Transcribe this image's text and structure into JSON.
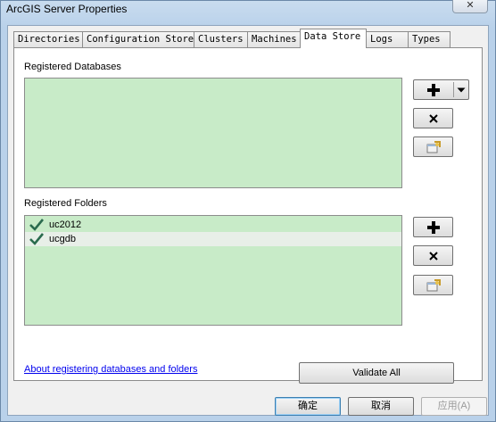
{
  "window": {
    "title": "ArcGIS Server Properties",
    "close_label": "✕"
  },
  "tabs": [
    {
      "label": "Directories"
    },
    {
      "label": "Configuration Store"
    },
    {
      "label": "Clusters"
    },
    {
      "label": "Machines"
    },
    {
      "label": "Data Store"
    },
    {
      "label": "Logs"
    },
    {
      "label": "Types"
    }
  ],
  "active_tab": "Data Store",
  "databases": {
    "label": "Registered Databases",
    "items": []
  },
  "folders": {
    "label": "Registered Folders",
    "items": [
      {
        "name": "uc2012",
        "status_icon": "check-icon"
      },
      {
        "name": "ucgdb",
        "status_icon": "check-icon"
      }
    ]
  },
  "link_text": "About registering databases and folders",
  "validate_label": "Validate All",
  "dialog_buttons": {
    "ok": "确定",
    "cancel": "取消",
    "apply": "应用(A)"
  },
  "colors": {
    "list_background": "#c8ebc8",
    "check_color": "#2a6b4e",
    "link_color": "#0000ee"
  }
}
